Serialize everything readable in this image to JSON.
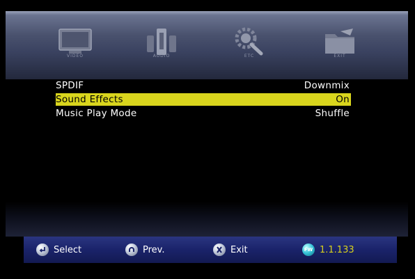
{
  "tabs": [
    {
      "name": "tab-video",
      "icon": "tv-icon",
      "label": "VIDEO"
    },
    {
      "name": "tab-audio",
      "icon": "speakers-icon",
      "label": "AUDIO"
    },
    {
      "name": "tab-etc",
      "icon": "gear-magnifier-icon",
      "label": "ETC"
    },
    {
      "name": "tab-exit",
      "icon": "folder-exit-icon",
      "label": "EXIT"
    }
  ],
  "menu": {
    "rows": [
      {
        "label": "SPDIF",
        "value": "Downmix"
      },
      {
        "label": "Sound Effects",
        "value": "On",
        "selected": true
      },
      {
        "label": "Music Play Mode",
        "value": "Shuffle"
      }
    ]
  },
  "footer": {
    "select": "Select",
    "prev": "Prev.",
    "exit": "Exit",
    "fw_badge": "FW",
    "fw_version": "1.1.133"
  },
  "colors": {
    "highlight": "#d9d51d",
    "footer_bg": "#1a236a",
    "version_text": "#d9d21c"
  }
}
